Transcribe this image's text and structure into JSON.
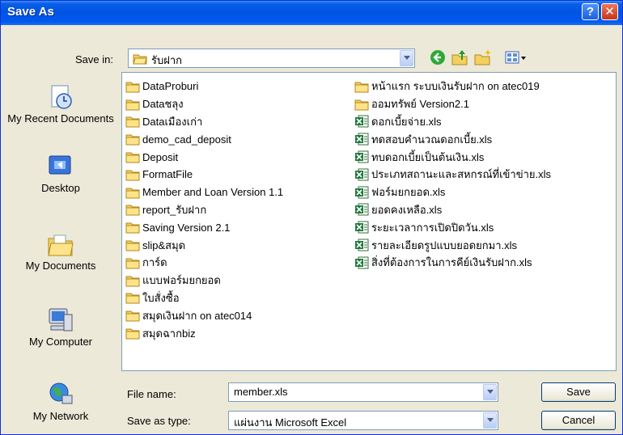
{
  "window": {
    "title": "Save As"
  },
  "save_in": {
    "label": "Save in:",
    "value": "รับฝาก"
  },
  "places": [
    {
      "name": "my-recent-documents",
      "label": "My Recent Documents"
    },
    {
      "name": "desktop",
      "label": "Desktop"
    },
    {
      "name": "my-documents",
      "label": "My Documents"
    },
    {
      "name": "my-computer",
      "label": "My Computer"
    },
    {
      "name": "my-network",
      "label": "My Network"
    }
  ],
  "files_left": [
    {
      "label": "DataProburi",
      "icon": "folder-icon"
    },
    {
      "label": "Dataชลุง",
      "icon": "folder-icon"
    },
    {
      "label": "Dataเมืองเก่า",
      "icon": "folder-icon"
    },
    {
      "label": "demo_cad_deposit",
      "icon": "folder-icon"
    },
    {
      "label": "Deposit",
      "icon": "folder-icon"
    },
    {
      "label": "FormatFile",
      "icon": "folder-icon"
    },
    {
      "label": "Member and Loan Version 1.1",
      "icon": "folder-icon"
    },
    {
      "label": "report_รับฝาก",
      "icon": "folder-icon"
    },
    {
      "label": "Saving Version 2.1",
      "icon": "folder-icon"
    },
    {
      "label": "slip&สมุด",
      "icon": "folder-icon"
    },
    {
      "label": "การ์ด",
      "icon": "folder-icon"
    },
    {
      "label": "แบบฟอร์มยกยอด",
      "icon": "folder-icon"
    },
    {
      "label": "ใบสั่งซื้อ",
      "icon": "folder-icon"
    },
    {
      "label": "สมุดเงินฝาก on atec014",
      "icon": "folder-icon"
    },
    {
      "label": "สมุดฉากbiz",
      "icon": "folder-icon"
    }
  ],
  "files_right": [
    {
      "label": "หน้าแรก ระบบเงินรับฝาก on atec019",
      "icon": "folder-icon"
    },
    {
      "label": "ออมทรัพย์ Version2.1",
      "icon": "folder-icon"
    },
    {
      "label": "ดอกเบี้ยจ่าย.xls",
      "icon": "excel-file-icon"
    },
    {
      "label": "ทดสอบคำนวณดอกเบี้ย.xls",
      "icon": "excel-file-icon"
    },
    {
      "label": "ทบดอกเบี้ยเป็นต้นเงิน.xls",
      "icon": "excel-file-icon"
    },
    {
      "label": "ประเภทสถานะและสหกรณ์ที่เข้าข่าย.xls",
      "icon": "excel-file-icon"
    },
    {
      "label": "ฟอร์มยกยอด.xls",
      "icon": "excel-file-icon"
    },
    {
      "label": "ยอดคงเหลือ.xls",
      "icon": "excel-file-icon"
    },
    {
      "label": "ระยะเวลาการเปิดปิดวัน.xls",
      "icon": "excel-file-icon"
    },
    {
      "label": "รายละเอียดรูปแบบยอดยกมา.xls",
      "icon": "excel-file-icon"
    },
    {
      "label": "สิ่งที่ต้องการในการคีย์เงินรับฝาก.xls",
      "icon": "excel-file-icon"
    }
  ],
  "file_name": {
    "label": "File name:",
    "value": "member.xls"
  },
  "save_as_type": {
    "label": "Save as type:",
    "value": "แผ่นงาน Microsoft Excel"
  },
  "buttons": {
    "save": "Save",
    "cancel": "Cancel"
  },
  "colors": {
    "title_bar": "#0054e3",
    "dialog_bg": "#ece9d8",
    "border": "#7f9db9",
    "folder": "#f4d060",
    "excel": "#1d7a3a"
  }
}
